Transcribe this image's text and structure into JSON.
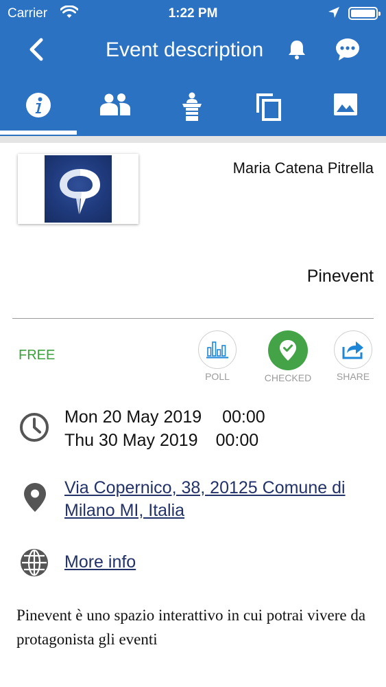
{
  "status_bar": {
    "carrier": "Carrier",
    "time": "1:22 PM"
  },
  "navbar": {
    "title": "Event description"
  },
  "tabs": [
    {
      "icon": "info-icon",
      "active": true
    },
    {
      "icon": "people-icon",
      "active": false
    },
    {
      "icon": "speaker-podium-icon",
      "active": false
    },
    {
      "icon": "copy-documents-icon",
      "active": false
    },
    {
      "icon": "gallery-image-icon",
      "active": false
    }
  ],
  "event": {
    "organizer": "Maria Catena Pitrella",
    "venue_name": "Pinevent",
    "price_label": "FREE",
    "actions": {
      "poll": "POLL",
      "checked": "CHECKED",
      "share": "SHARE"
    },
    "start_date": "Mon 20 May 2019",
    "start_time": "00:00",
    "end_date": "Thu 30 May 2019",
    "end_time": "00:00",
    "address": "Via Copernico, 38, 20125 Comune di Milano MI, Italia",
    "more_info": "More info",
    "description": "Pinevent è uno spazio interattivo in cui potrai vivere da protagonista gli eventi"
  },
  "colors": {
    "header_blue": "#2b72c2",
    "free_green": "#3aa13a",
    "checked_green": "#44a347",
    "link_navy": "#223268",
    "icon_gray": "#555555",
    "share_blue": "#1d86d6"
  }
}
